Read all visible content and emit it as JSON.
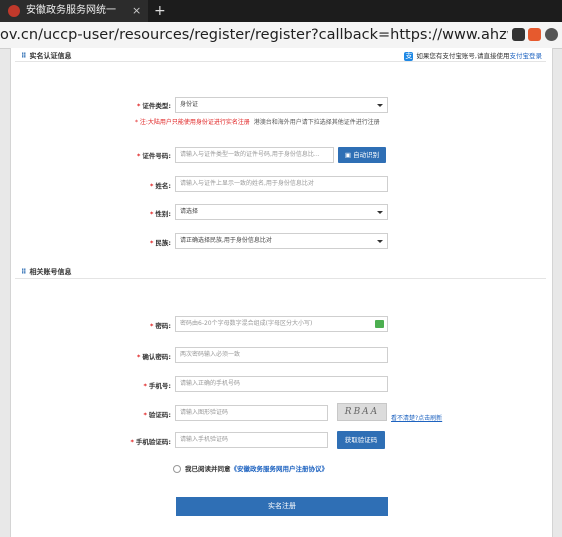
{
  "browser": {
    "tab_title": "安徽政务服务网统一",
    "tab_close": "×",
    "new_tab": "+",
    "url": "ov.cn/uccp-user/resources/register/register?callback=https://www.ahzwfw.gov.cn&appC"
  },
  "sections": {
    "realname": "实名认证信息",
    "account": "相关账号信息"
  },
  "alipay": {
    "text": "如果您有支付宝账号,请直接使用",
    "link": "支付宝登录"
  },
  "form": {
    "cert_type": {
      "label": "证件类型:",
      "value": "身份证"
    },
    "note_red": "* 注:大陆用户只能使用身份证进行实名注册",
    "note_rest": "港澳台和海外用户请下拉选择其他证件进行注册",
    "cert_no": {
      "label": "证件号码:",
      "placeholder": "请输入与证件类型一致的证件号码,用于身份信息比...",
      "button": "自动识别"
    },
    "name": {
      "label": "姓名:",
      "placeholder": "请输入与证件上显示一致的姓名,用于身份信息比对"
    },
    "gender": {
      "label": "性别:",
      "value": "请选择"
    },
    "ethnic": {
      "label": "民族:",
      "value": "请正确选择民族,用于身份信息比对"
    },
    "password": {
      "label": "密码:",
      "placeholder": "密码由6-20个字母数字混合组成(字母区分大小写)"
    },
    "confirm": {
      "label": "确认密码:",
      "placeholder": "两次密码输入必须一致"
    },
    "phone": {
      "label": "手机号:",
      "placeholder": "请输入正确的手机号码"
    },
    "captcha": {
      "label": "验证码:",
      "placeholder": "请输入图形验证码",
      "image_text": "RBAA",
      "refresh": "看不清楚?点击刷新"
    },
    "sms": {
      "label": "手机验证码:",
      "placeholder": "请输入手机验证码",
      "button": "获取验证码"
    },
    "agree_text": "我已阅读并同意",
    "agree_link": "《安徽政务服务网用户注册协议》",
    "submit": "实名注册",
    "required_mark": "*"
  },
  "colors": {
    "primary": "#2f6fb5",
    "required": "#e02020",
    "link": "#1e63c0"
  }
}
